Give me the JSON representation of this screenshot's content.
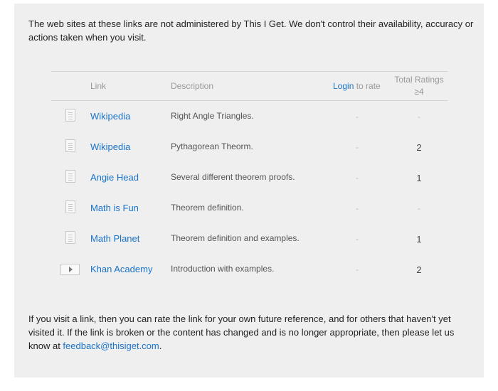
{
  "intro": "The web sites at these links are not administered by This I Get. We don't control their availability, accuracy or actions taken when you visit.",
  "table": {
    "headers": {
      "link": "Link",
      "description": "Description",
      "login": "Login",
      "to_rate": " to rate",
      "total_ratings_line1": "Total Ratings",
      "total_ratings_line2": "≥4"
    },
    "rows": [
      {
        "icon": "document-icon",
        "link": "Wikipedia",
        "description": "Right Angle Triangles.",
        "rate": "-",
        "total": "-"
      },
      {
        "icon": "document-icon",
        "link": "Wikipedia",
        "description": "Pythagorean Theorm.",
        "rate": "-",
        "total": "2"
      },
      {
        "icon": "document-icon",
        "link": "Angie Head",
        "description": "Several different theorem proofs.",
        "rate": "-",
        "total": "1"
      },
      {
        "icon": "document-icon",
        "link": "Math is Fun",
        "description": "Theorem definition.",
        "rate": "-",
        "total": "-"
      },
      {
        "icon": "document-icon",
        "link": "Math Planet",
        "description": "Theorem definition and examples.",
        "rate": "-",
        "total": "1"
      },
      {
        "icon": "video-play-icon",
        "link": "Khan Academy",
        "description": "Introduction with examples.",
        "rate": "-",
        "total": "2"
      }
    ]
  },
  "footer": {
    "text": "If you visit a link, then you can rate the link for your own future reference, and for others that haven't yet visited it. If the link is broken or the content has changed and is no longer appropriate, then please let us know at ",
    "email": "feedback@thisiget.com",
    "end": "."
  },
  "colors": {
    "link": "#1a73c9",
    "panel_bg": "#efefef"
  }
}
